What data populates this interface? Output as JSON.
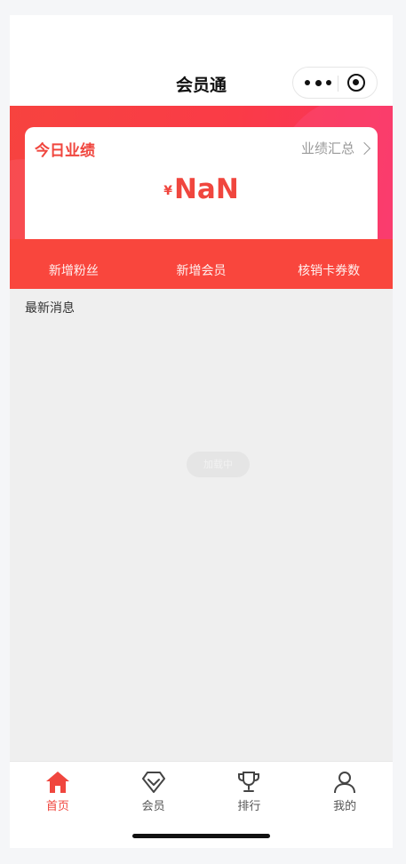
{
  "nav": {
    "title": "会员通"
  },
  "card": {
    "title": "今日业绩",
    "summary_link": "业绩汇总",
    "currency": "¥",
    "amount": "NaN"
  },
  "stats": [
    "新增粉丝",
    "新增会员",
    "核销卡券数"
  ],
  "section": {
    "title": "最新消息"
  },
  "loading": "加载中",
  "tabbar": {
    "active": "首页",
    "items": [
      {
        "label": "首页",
        "icon": "home-icon"
      },
      {
        "label": "会员",
        "icon": "diamond-icon"
      },
      {
        "label": "排行",
        "icon": "trophy-icon"
      },
      {
        "label": "我的",
        "icon": "user-icon"
      }
    ]
  },
  "colors": {
    "accent": "#f0463e",
    "banner": "#fa3b47"
  }
}
